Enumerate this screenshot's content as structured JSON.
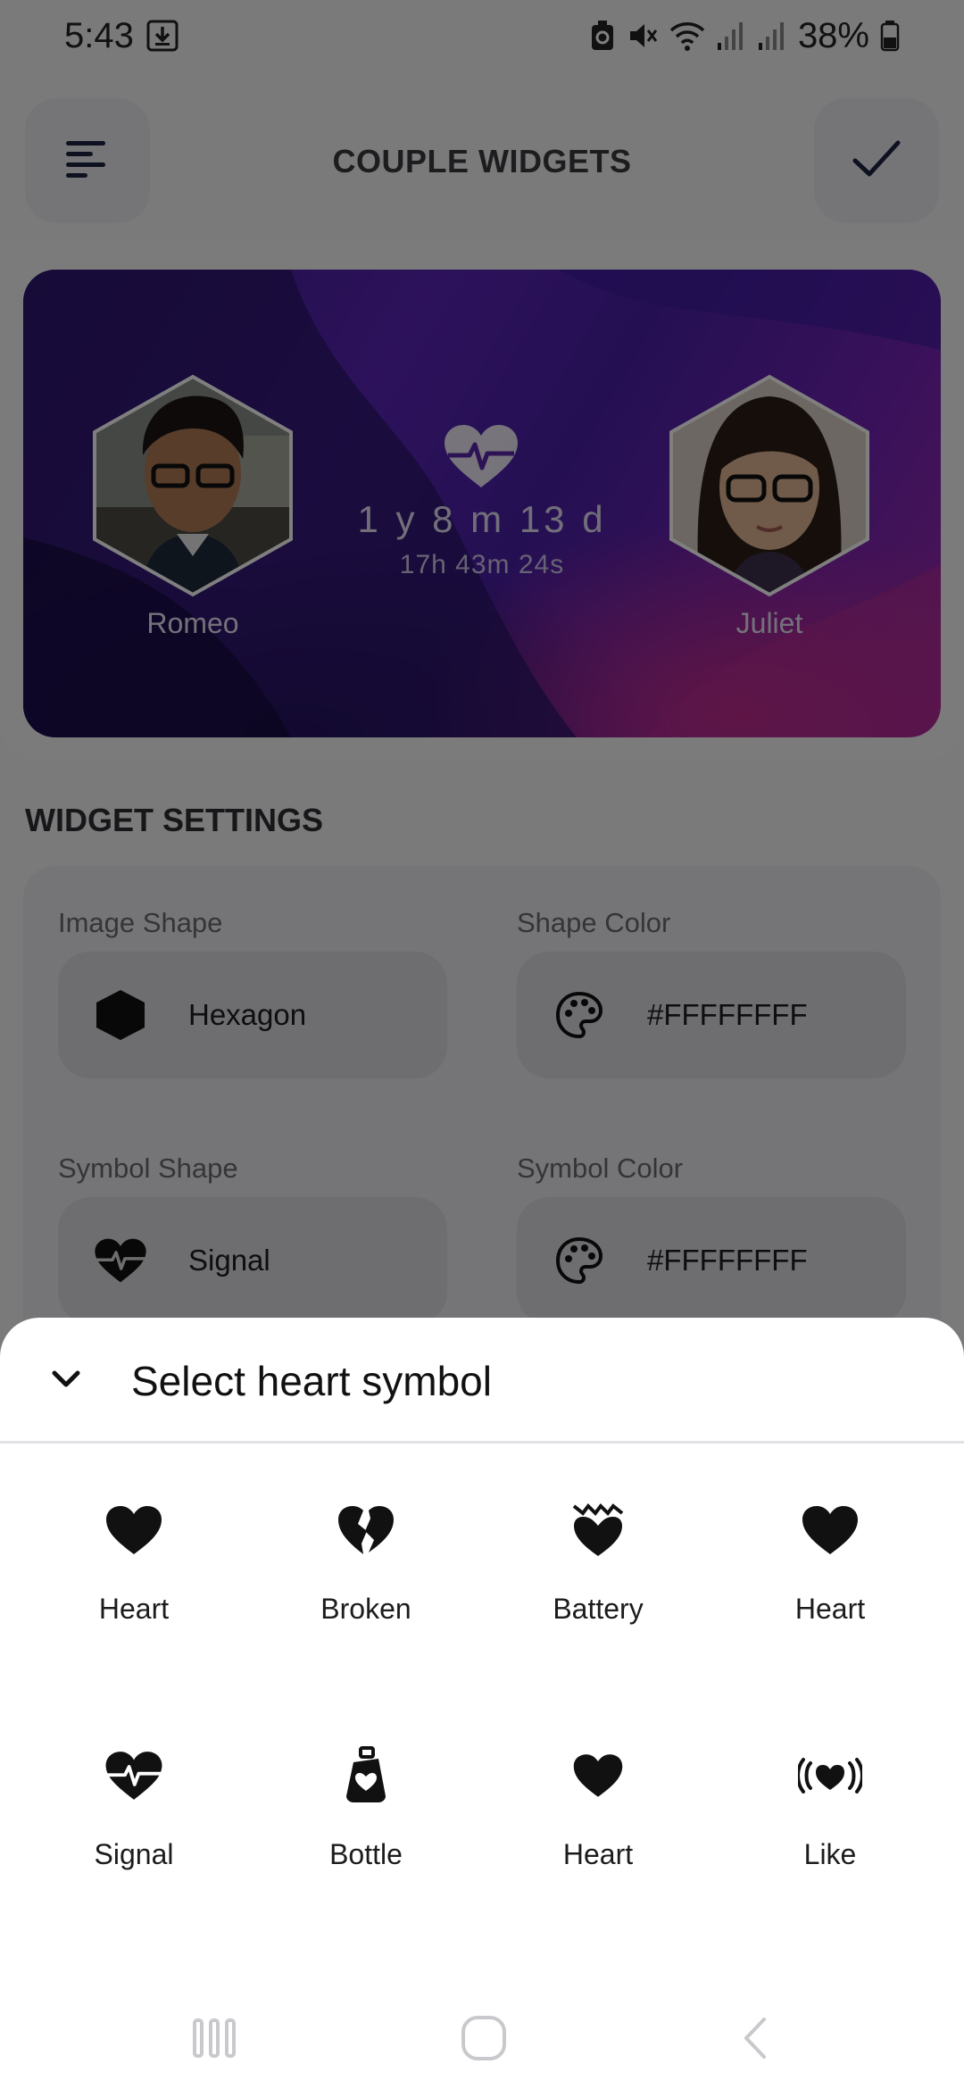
{
  "status_bar": {
    "time": "5:43",
    "battery": "38%",
    "icons": [
      "download-icon",
      "data-saver-icon",
      "mute-icon",
      "wifi-icon",
      "signal-icon",
      "signal-icon",
      "battery-icon"
    ]
  },
  "app_bar": {
    "title": "COUPLE WIDGETS",
    "menu_icon": "menu-icon",
    "confirm_icon": "check-icon"
  },
  "widget": {
    "left_person": "Romeo",
    "right_person": "Juliet",
    "duration_main": "1 y 8 m 13 d",
    "duration_sub": "17h 43m 24s",
    "symbol_icon": "heart-pulse-icon"
  },
  "settings": {
    "section_title": "WIDGET SETTINGS",
    "image_shape_label": "Image Shape",
    "image_shape_value": "Hexagon",
    "shape_color_label": "Shape Color",
    "shape_color_value": "#FFFFFFFF",
    "symbol_shape_label": "Symbol Shape",
    "symbol_shape_value": "Signal",
    "symbol_color_label": "Symbol Color",
    "symbol_color_value": "#FFFFFFFF"
  },
  "sheet": {
    "title": "Select heart symbol",
    "collapse_icon": "chevron-down-icon",
    "symbols": [
      {
        "label": "Heart",
        "icon": "heart-icon"
      },
      {
        "label": "Broken",
        "icon": "broken-heart-icon"
      },
      {
        "label": "Battery",
        "icon": "battery-heart-icon"
      },
      {
        "label": "Heart",
        "icon": "heart-icon"
      },
      {
        "label": "Signal",
        "icon": "heart-pulse-icon"
      },
      {
        "label": "Bottle",
        "icon": "bottle-heart-icon"
      },
      {
        "label": "Heart",
        "icon": "heart-icon"
      },
      {
        "label": "Like",
        "icon": "like-heart-icon"
      }
    ]
  },
  "nav_bar": {
    "icons": [
      "recent-apps-icon",
      "home-icon",
      "back-icon"
    ]
  },
  "colors": {
    "sheet_bg": "#ffffff",
    "widget_gradient_start": "#3a1c8a",
    "widget_gradient_end": "#a02aa8",
    "accent_dark": "#1c2340"
  }
}
